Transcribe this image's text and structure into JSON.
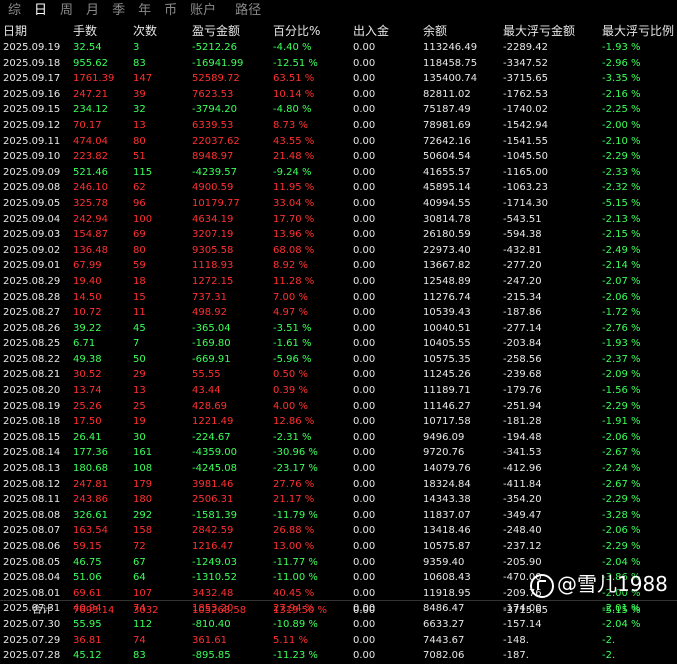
{
  "tabs": [
    "综",
    "日",
    "周",
    "月",
    "季",
    "年",
    "币",
    "账户",
    "路径"
  ],
  "active_tab_index": 1,
  "columns": [
    "日期",
    "手数",
    "次数",
    "盈亏金额",
    "百分比%",
    "出入金",
    "余额",
    "最大浮亏金额",
    "最大浮亏比例"
  ],
  "rows": [
    [
      "2025.09.19",
      "32.54",
      "3",
      "-5212.26",
      "-4.40 %",
      "0.00",
      "113246.49",
      "-2289.42",
      "-1.93 %",
      "g"
    ],
    [
      "2025.09.18",
      "955.62",
      "83",
      "-16941.99",
      "-12.51 %",
      "0.00",
      "118458.75",
      "-3347.52",
      "-2.96 %",
      "g"
    ],
    [
      "2025.09.17",
      "1761.39",
      "147",
      "52589.72",
      "63.51 %",
      "0.00",
      "135400.74",
      "-3715.65",
      "-3.35 %",
      "r"
    ],
    [
      "2025.09.16",
      "247.21",
      "39",
      "7623.53",
      "10.14 %",
      "0.00",
      "82811.02",
      "-1762.53",
      "-2.16 %",
      "r"
    ],
    [
      "2025.09.15",
      "234.12",
      "32",
      "-3794.20",
      "-4.80 %",
      "0.00",
      "75187.49",
      "-1740.02",
      "-2.25 %",
      "g"
    ],
    [
      "2025.09.12",
      "70.17",
      "13",
      "6339.53",
      "8.73 %",
      "0.00",
      "78981.69",
      "-1542.94",
      "-2.00 %",
      "r"
    ],
    [
      "2025.09.11",
      "474.04",
      "80",
      "22037.62",
      "43.55 %",
      "0.00",
      "72642.16",
      "-1541.55",
      "-2.10 %",
      "r"
    ],
    [
      "2025.09.10",
      "223.82",
      "51",
      "8948.97",
      "21.48 %",
      "0.00",
      "50604.54",
      "-1045.50",
      "-2.29 %",
      "r"
    ],
    [
      "2025.09.09",
      "521.46",
      "115",
      "-4239.57",
      "-9.24 %",
      "0.00",
      "41655.57",
      "-1165.00",
      "-2.33 %",
      "g"
    ],
    [
      "2025.09.08",
      "246.10",
      "62",
      "4900.59",
      "11.95 %",
      "0.00",
      "45895.14",
      "-1063.23",
      "-2.32 %",
      "r"
    ],
    [
      "2025.09.05",
      "325.78",
      "96",
      "10179.77",
      "33.04 %",
      "0.00",
      "40994.55",
      "-1714.30",
      "-5.15 %",
      "r"
    ],
    [
      "2025.09.04",
      "242.94",
      "100",
      "4634.19",
      "17.70 %",
      "0.00",
      "30814.78",
      "-543.51",
      "-2.13 %",
      "r"
    ],
    [
      "2025.09.03",
      "154.87",
      "69",
      "3207.19",
      "13.96 %",
      "0.00",
      "26180.59",
      "-594.38",
      "-2.15 %",
      "r"
    ],
    [
      "2025.09.02",
      "136.48",
      "80",
      "9305.58",
      "68.08 %",
      "0.00",
      "22973.40",
      "-432.81",
      "-2.49 %",
      "r"
    ],
    [
      "2025.09.01",
      "67.99",
      "59",
      "1118.93",
      "8.92 %",
      "0.00",
      "13667.82",
      "-277.20",
      "-2.14 %",
      "r"
    ],
    [
      "2025.08.29",
      "19.40",
      "18",
      "1272.15",
      "11.28 %",
      "0.00",
      "12548.89",
      "-247.20",
      "-2.07 %",
      "r"
    ],
    [
      "2025.08.28",
      "14.50",
      "15",
      "737.31",
      "7.00 %",
      "0.00",
      "11276.74",
      "-215.34",
      "-2.06 %",
      "r"
    ],
    [
      "2025.08.27",
      "10.72",
      "11",
      "498.92",
      "4.97 %",
      "0.00",
      "10539.43",
      "-187.86",
      "-1.72 %",
      "r"
    ],
    [
      "2025.08.26",
      "39.22",
      "45",
      "-365.04",
      "-3.51 %",
      "0.00",
      "10040.51",
      "-277.14",
      "-2.76 %",
      "g"
    ],
    [
      "2025.08.25",
      "6.71",
      "7",
      "-169.80",
      "-1.61 %",
      "0.00",
      "10405.55",
      "-203.84",
      "-1.93 %",
      "g"
    ],
    [
      "2025.08.22",
      "49.38",
      "50",
      "-669.91",
      "-5.96 %",
      "0.00",
      "10575.35",
      "-258.56",
      "-2.37 %",
      "g"
    ],
    [
      "2025.08.21",
      "30.52",
      "29",
      "55.55",
      "0.50 %",
      "0.00",
      "11245.26",
      "-239.68",
      "-2.09 %",
      "r"
    ],
    [
      "2025.08.20",
      "13.74",
      "13",
      "43.44",
      "0.39 %",
      "0.00",
      "11189.71",
      "-179.76",
      "-1.56 %",
      "r"
    ],
    [
      "2025.08.19",
      "25.26",
      "25",
      "428.69",
      "4.00 %",
      "0.00",
      "11146.27",
      "-251.94",
      "-2.29 %",
      "r"
    ],
    [
      "2025.08.18",
      "17.50",
      "19",
      "1221.49",
      "12.86 %",
      "0.00",
      "10717.58",
      "-181.28",
      "-1.91 %",
      "r"
    ],
    [
      "2025.08.15",
      "26.41",
      "30",
      "-224.67",
      "-2.31 %",
      "0.00",
      "9496.09",
      "-194.48",
      "-2.06 %",
      "g"
    ],
    [
      "2025.08.14",
      "177.36",
      "161",
      "-4359.00",
      "-30.96 %",
      "0.00",
      "9720.76",
      "-341.53",
      "-2.67 %",
      "g"
    ],
    [
      "2025.08.13",
      "180.68",
      "108",
      "-4245.08",
      "-23.17 %",
      "0.00",
      "14079.76",
      "-412.96",
      "-2.24 %",
      "g"
    ],
    [
      "2025.08.12",
      "247.81",
      "179",
      "3981.46",
      "27.76 %",
      "0.00",
      "18324.84",
      "-411.84",
      "-2.67 %",
      "r"
    ],
    [
      "2025.08.11",
      "243.86",
      "180",
      "2506.31",
      "21.17 %",
      "0.00",
      "14343.38",
      "-354.20",
      "-2.29 %",
      "r"
    ],
    [
      "2025.08.08",
      "326.61",
      "292",
      "-1581.39",
      "-11.79 %",
      "0.00",
      "11837.07",
      "-349.47",
      "-3.28 %",
      "g"
    ],
    [
      "2025.08.07",
      "163.54",
      "158",
      "2842.59",
      "26.88 %",
      "0.00",
      "13418.46",
      "-248.40",
      "-2.06 %",
      "r"
    ],
    [
      "2025.08.06",
      "59.15",
      "72",
      "1216.47",
      "13.00 %",
      "0.00",
      "10575.87",
      "-237.12",
      "-2.29 %",
      "r"
    ],
    [
      "2025.08.05",
      "46.75",
      "67",
      "-1249.03",
      "-11.77 %",
      "0.00",
      "9359.40",
      "-205.90",
      "-2.04 %",
      "g"
    ],
    [
      "2025.08.04",
      "51.06",
      "64",
      "-1310.52",
      "-11.00 %",
      "0.00",
      "10608.43",
      "-470.00",
      "-3.86 %",
      "g"
    ],
    [
      "2025.08.01",
      "69.61",
      "107",
      "3432.48",
      "40.45 %",
      "0.00",
      "11918.95",
      "-209.76",
      "-2.00 %",
      "r"
    ],
    [
      "2025.07.31",
      "40.94",
      "74",
      "1853.20",
      "27.94 %",
      "0.00",
      "8486.47",
      "-174.00",
      "-2.01 %",
      "r"
    ],
    [
      "2025.07.30",
      "55.95",
      "112",
      "-810.40",
      "-10.89 %",
      "0.00",
      "6633.27",
      "-157.14",
      "-2.04 %",
      "g"
    ],
    [
      "2025.07.29",
      "36.81",
      "74",
      "361.61",
      "5.11 %",
      "0.00",
      "7443.67",
      "-148.",
      "-2.",
      "r"
    ],
    [
      "2025.07.28",
      "45.12",
      "83",
      "-895.85",
      "-11.23 %",
      "0.00",
      "7082.06",
      "-187.",
      "-2.",
      "g"
    ]
  ],
  "footer": {
    "label": "合计",
    "lots": "7693.14",
    "count": "3032",
    "pnl": "105268.58",
    "pct": "1319.50 %",
    "flow": "0.00",
    "balance": "",
    "max_dd": "-3715.65",
    "max_dd_pct": "-5.15 %"
  },
  "watermark": "@雪儿1988",
  "colors": {
    "profit": "#ff3030",
    "loss": "#3cff5a",
    "background": "#000000"
  }
}
